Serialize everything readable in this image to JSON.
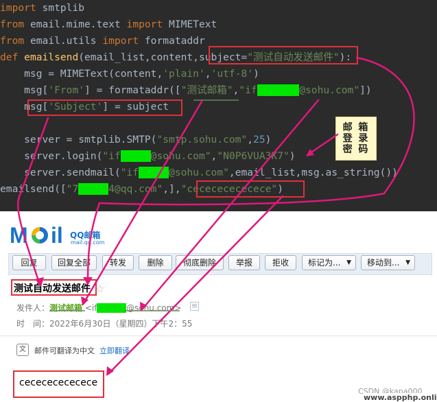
{
  "code": {
    "line1": {
      "kw": "import",
      "rest": " smtplib"
    },
    "line2": {
      "kw1": "from",
      "mod": " email.mime.text ",
      "kw2": "import",
      "rest": " MIMEText"
    },
    "line3": {
      "kw1": "from",
      "mod": " email.utils ",
      "kw2": "import",
      "rest": " formataddr"
    },
    "line4": {
      "kw": "def",
      "fn": "emailsend",
      "params": "(email_list,content,",
      "param_name": "subject=",
      "param_default": "\"测试自动发送邮件\"",
      "end": "):"
    },
    "line5": {
      "a": "    msg = MIMEText(content,",
      "s1": "'plain'",
      "c": ",",
      "s2": "'utf-8'",
      "e": ")"
    },
    "line6": {
      "a": "    msg[",
      "s1": "'From'",
      "b": "] = formataddr([",
      "s2": "\"测试邮箱\"",
      "c": ",",
      "s3a": "\"if",
      "s3b": "@sohu.com\"",
      "e": "])"
    },
    "line7": {
      "a": "    msg[",
      "s1": "'Subject'",
      "e": "] = subject"
    },
    "line9": {
      "a": "    server = smtplib.SMTP(",
      "s1": "\"smtp.sohu.com\"",
      "c": ",",
      "n": "25",
      "e": ")"
    },
    "line10": {
      "a": "    server.login(",
      "s1a": "\"if",
      "s1b": "@sohu.com\"",
      "c": ",",
      "s2": "\"N0P6VUA3K7\"",
      "e": ")"
    },
    "line11": {
      "a": "    server.sendmail(",
      "s1a": "\"if",
      "s1b": "@sohu.com\"",
      "e": ",email_list,msg.as_string())"
    },
    "line12": {
      "a": "emailsend([",
      "s1a": "\"7",
      "s1b": "4@qq.com\"",
      "c": ",],",
      "s2": "\"cecececececece\"",
      "e": ")"
    }
  },
  "annotation": {
    "label": "邮箱登录密码",
    "line_a": "邮 箱",
    "line_b": "登 录",
    "line_c": "密 码"
  },
  "mail": {
    "logo_text": "MOil",
    "logo_cn": "QQ邮箱",
    "logo_url": "mail.qq.com",
    "toolbar": {
      "reply": "回复",
      "reply_all": "回复全部",
      "forward": "转发",
      "delete": "删除",
      "perm_delete": "彻底删除",
      "report": "举报",
      "reject": "拒收",
      "mark_as": "标记为...",
      "move_to": "移动到..."
    },
    "subject": "测试自动发送邮件",
    "sender_label": "发件人：",
    "sender_name": "测试邮箱",
    "sender_addr_a": "<if",
    "sender_addr_b": "@sohu.com>",
    "time_label": "时　间：",
    "time_value": "2022年6月30日（星期四）下午2：55",
    "translate_text": "邮件可翻译为中文",
    "translate_link": "立即翻译",
    "body": "cecececececece"
  },
  "watermark": {
    "line1": "CSDN @kapa000",
    "line2": "www.aspphp.online"
  },
  "colors": {
    "editor_bg": "#2b2b2b",
    "keyword": "#cc7832",
    "string": "#6a8759",
    "function": "#ffc66d",
    "annotation_line": "#e0187a",
    "box": "#e0303a",
    "redaction": "#00e600"
  },
  "icons": [
    "star-icon",
    "contact-card-icon",
    "translate-icon",
    "chevron-down-icon"
  ]
}
